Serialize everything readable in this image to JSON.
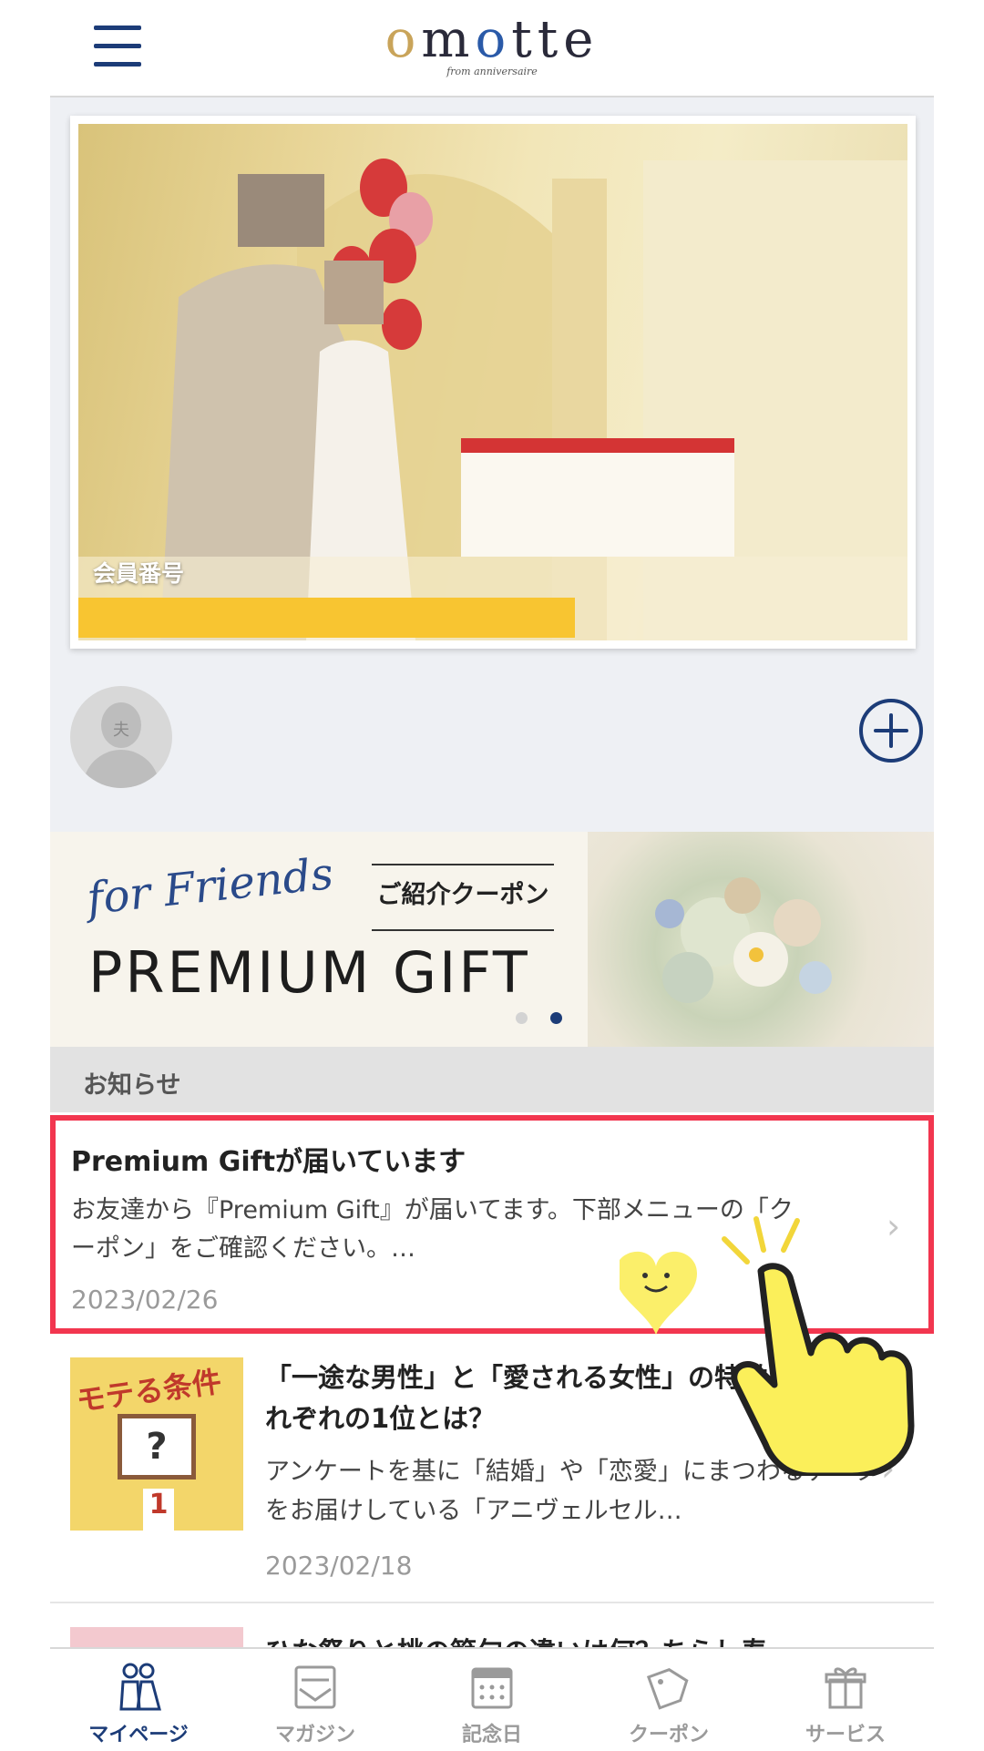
{
  "header": {
    "logo_text": "omotte",
    "logo_sub": "from anniversaire"
  },
  "profile": {
    "member_number_label": "会員番号",
    "avatar_tag": "夫"
  },
  "banner": {
    "script_text": "for Friends",
    "coupon_label": "ご紹介クーポン",
    "headline": "PREMIUM GIFT",
    "active_slide": 2,
    "slide_count": 2
  },
  "notices": {
    "section_title": "お知らせ",
    "items": [
      {
        "title": "Premium Giftが届いています",
        "body": "お友達から『Premium Gift』が届いてます。下部メニューの「クーポン」をご確認ください。…",
        "date": "2023/02/26"
      }
    ]
  },
  "articles": [
    {
      "thumb_title": "モテる条件",
      "title": "「一途な男性」と「愛される女性」の特徴を調査！それぞれの1位とは？",
      "body": "アンケートを基に「結婚」や「恋愛」にまつわるデータをお届けしている「アニヴェルセル…",
      "date": "2023/02/18"
    },
    {
      "title": "ひな祭りと桃の節句の違いは何？ちらし寿"
    }
  ],
  "tabbar": {
    "tabs": [
      {
        "label": "マイページ",
        "icon": "couple-icon",
        "active": true
      },
      {
        "label": "マガジン",
        "icon": "news-icon",
        "active": false
      },
      {
        "label": "記念日",
        "icon": "calendar-icon",
        "active": false
      },
      {
        "label": "クーポン",
        "icon": "coupon-icon",
        "active": false
      },
      {
        "label": "サービス",
        "icon": "gift-icon",
        "active": false
      }
    ]
  },
  "colors": {
    "brand_navy": "#1c3c78",
    "highlight_red": "#f2364f",
    "member_bar_yellow": "#f8c531"
  }
}
